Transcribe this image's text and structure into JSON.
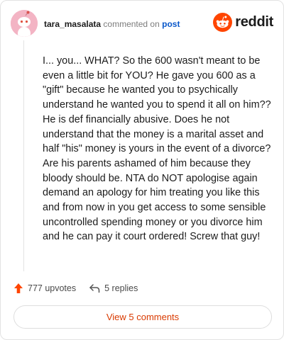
{
  "header": {
    "username": "tara_masalata",
    "action_text": "commented on",
    "post_link": "post"
  },
  "brand": {
    "name": "reddit",
    "logo_icon": "reddit-snoo-icon",
    "accent_color": "#ff4500"
  },
  "comment": {
    "body": "I... you... WHAT? So the 600 wasn't meant to be even a little bit for YOU? He gave you 600 as a \"gift\" because he wanted you to psychically understand he wanted you to spend it all on him?? He is def financially abusive. Does he not understand that the money is a marital asset and half \"his\" money is yours in the event of a divorce? Are his parents ashamed of him because they bloody should be. NTA do NOT apologise again demand an apology for him treating you like this and from now in you get access to some sensible uncontrolled spending money or you divorce him and he can pay it court ordered! Screw that guy!"
  },
  "actions": {
    "upvotes_label": "777 upvotes",
    "upvote_icon": "upvote-arrow-icon",
    "replies_label": "5 replies",
    "reply_icon": "reply-arrow-icon"
  },
  "footer": {
    "view_comments_label": "View 5 comments"
  }
}
